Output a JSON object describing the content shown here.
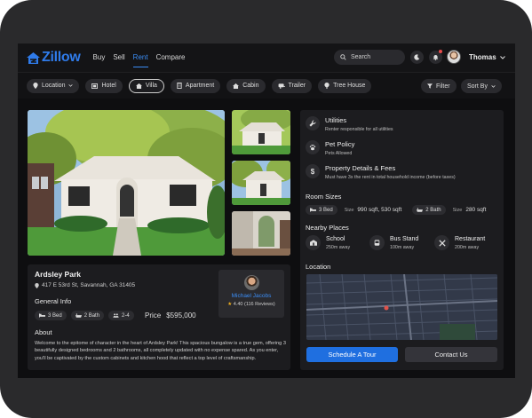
{
  "brand": {
    "name": "Zillow",
    "accent": "#1f6fe0"
  },
  "nav": {
    "items": [
      "Buy",
      "Sell",
      "Rent",
      "Compare"
    ],
    "active": "Rent"
  },
  "search": {
    "placeholder": "Search"
  },
  "user": {
    "name": "Thomas"
  },
  "filters": {
    "location": "Location",
    "types": [
      "Hotel",
      "Villa",
      "Apartment",
      "Cabin",
      "Trailer",
      "Tree House"
    ],
    "selected": "Villa",
    "filter_label": "Filter",
    "sort_label": "Sort By"
  },
  "property": {
    "name": "Ardsley Park",
    "address": "417 E 53rd St, Savannah, GA 31405",
    "general_info_label": "General Info",
    "beds": "3 Bed",
    "baths": "2 Bath",
    "guests": "2-4",
    "price_label": "Price",
    "price": "$595,000",
    "about_label": "About",
    "about_text": "Welcome to the epitome of character in the heart of Ardsley Park! This spacious bungalow is a true gem, offering 3 beautifully designed bedrooms and 2 bathrooms, all completely updated with no expense spared. As you enter, you'll be captivated by the custom cabinets and kitchen hood that reflect a top level of craftsmanship."
  },
  "agent": {
    "name": "Michael Jacobs",
    "rating": "4.40",
    "reviews": "(116 Reviews)"
  },
  "details": {
    "utilities": {
      "title": "Utilities",
      "sub": "Renter responsible for all utilities"
    },
    "pets": {
      "title": "Pet Policy",
      "sub": "Pets Allowed"
    },
    "fees": {
      "title": "Property Details & Fees",
      "sub": "Must have 3x the rent in total household income (before taxes)"
    },
    "room_sizes_label": "Room Sizes",
    "bed_chip": "3 Bed",
    "bed_size_label": "Size",
    "bed_size": "990 sqft, 530 sqft",
    "bath_chip": "2 Bath",
    "bath_size_label": "Size",
    "bath_size": "280 sqft",
    "nearby_label": "Nearby Places",
    "nearby": [
      {
        "name": "School",
        "dist": "250m away",
        "icon": "school-icon"
      },
      {
        "name": "Bus Stand",
        "dist": "100m away",
        "icon": "bus-icon"
      },
      {
        "name": "Restaurant",
        "dist": "200m away",
        "icon": "restaurant-icon"
      }
    ],
    "location_label": "Location"
  },
  "actions": {
    "schedule": "Schedule A Tour",
    "contact": "Contact Us"
  }
}
